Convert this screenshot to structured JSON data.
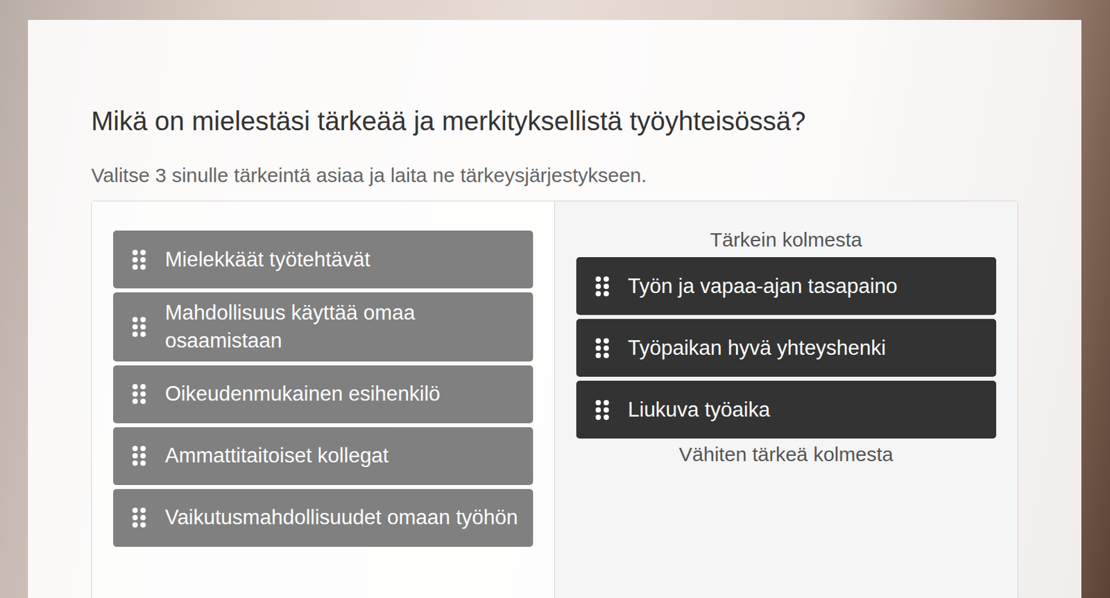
{
  "question": {
    "title": "Mikä on mielestäsi tärkeää ja merkityksellistä työyhteisössä?",
    "instruction": "Valitse 3 sinulle tärkeintä asiaa ja laita ne tärkeysjärjestykseen."
  },
  "available": [
    "Mielekkäät työtehtävät",
    "Mahdollisuus käyttää omaa osaamistaan",
    "Oikeudenmukainen esihenkilö",
    "Ammattitaitoiset kollegat",
    "Vaikutusmahdollisuudet omaan työhön"
  ],
  "ranking": {
    "top_label": "Tärkein kolmesta",
    "items": [
      "Työn ja vapaa-ajan tasapaino",
      "Työpaikan hyvä yhteyshenki",
      "Liukuva työaika"
    ],
    "bottom_label": "Vähiten tärkeä kolmesta"
  }
}
